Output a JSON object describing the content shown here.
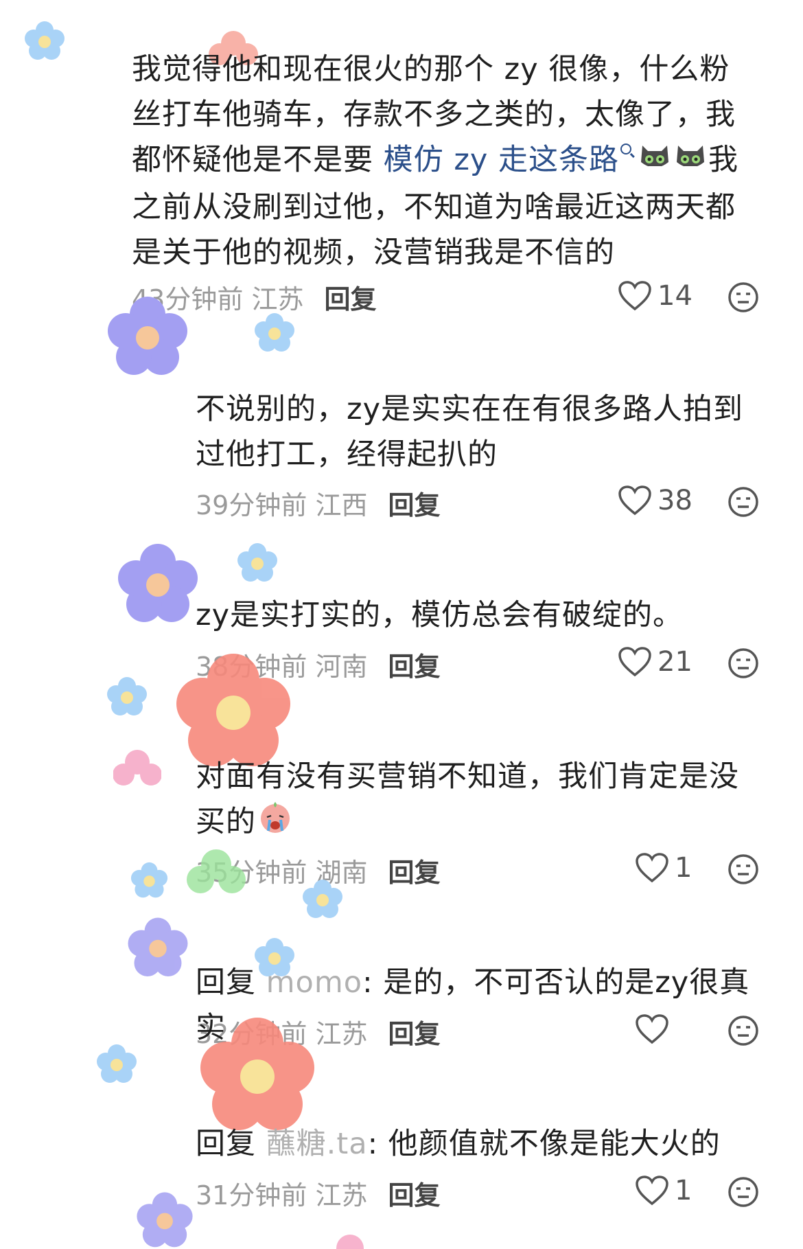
{
  "comments": [
    {
      "text_before": "我觉得他和现在很火的那个 zy 很像，什么粉丝打车他骑车，存款不多之类的，太像了，我都怀疑他是不是要 ",
      "link": "模仿 zy 走这条路",
      "text_after": "我之前从没刷到过他，不知道为啥最近这两天都是关于他的视频，没营销我是不信的",
      "emoji": "cat-face-emoji",
      "time": "43分钟前",
      "location": "江苏",
      "reply_label": "回复",
      "likes": "14"
    },
    {
      "text": "不说别的，zy是实实在在有很多路人拍到过他打工，经得起扒的",
      "time": "39分钟前",
      "location": "江西",
      "reply_label": "回复",
      "likes": "38"
    },
    {
      "text": "zy是实打实的，模仿总会有破绽的。",
      "time": "38分钟前",
      "location": "河南",
      "reply_label": "回复",
      "likes": "21"
    },
    {
      "text": "对面有没有买营销不知道，我们肯定是没买的",
      "emoji": "crying-face-emoji",
      "time": "35分钟前",
      "location": "湖南",
      "reply_label": "回复",
      "likes": "1"
    },
    {
      "reply_prefix": "回复 ",
      "mention": "momo",
      "text": ": 是的，不可否认的是zy很真实",
      "time": "32分钟前",
      "location": "江苏",
      "reply_label": "回复",
      "likes": ""
    },
    {
      "reply_prefix": "回复 ",
      "mention": "蘸糖.ta",
      "text": ": 他颜值就不像是能大火的",
      "time": "31分钟前",
      "location": "江苏",
      "reply_label": "回复",
      "likes": "1"
    }
  ],
  "colors": {
    "link": "#2b4f8a",
    "meta": "#9a9a9a",
    "flower_pink": "#f79a8e",
    "flower_purple": "#9c98f2",
    "flower_blue": "#8dc6f5"
  },
  "icons": [
    "heart-icon",
    "dislike-face-icon",
    "search-icon",
    "flower-sticker"
  ]
}
